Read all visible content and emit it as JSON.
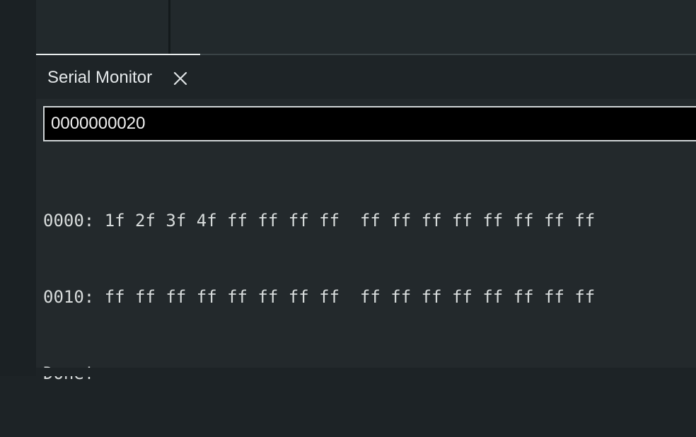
{
  "panel": {
    "tab_label": "Serial Monitor",
    "close_icon": "close-icon"
  },
  "input": {
    "value": "0000000020"
  },
  "output": {
    "lines": [
      "0000: 1f 2f 3f 4f ff ff ff ff  ff ff ff ff ff ff ff ff",
      "0010: ff ff ff ff ff ff ff ff  ff ff ff ff ff ff ff ff",
      "Done!"
    ]
  },
  "colors": {
    "background": "#1d2326",
    "panel": "#23292c",
    "input_background": "#000000",
    "text": "#d8dcdc"
  }
}
